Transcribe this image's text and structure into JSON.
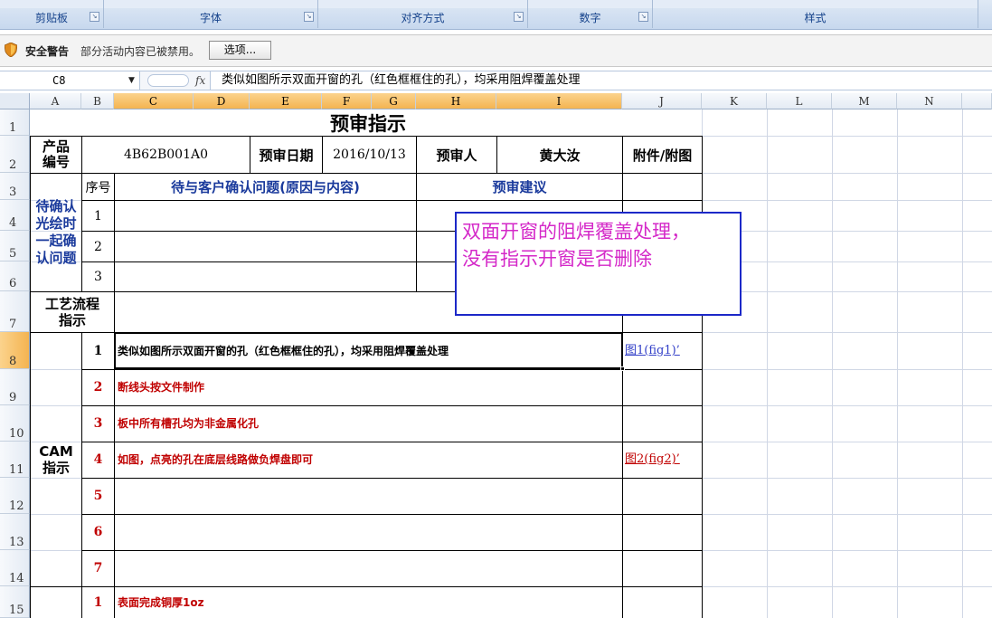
{
  "ribbon": {
    "groups": [
      "剪贴板",
      "字体",
      "对齐方式",
      "数字",
      "样式"
    ]
  },
  "security": {
    "title": "安全警告",
    "message": "部分活动内容已被禁用。",
    "options_button": "选项..."
  },
  "formula_bar": {
    "name_box": "C8",
    "fx": "fx",
    "content": "类似如图所示双面开窗的孔（红色框框住的孔），均采用阻焊覆盖处理"
  },
  "columns": [
    "A",
    "B",
    "C",
    "D",
    "E",
    "F",
    "G",
    "H",
    "I",
    "J",
    "K",
    "L",
    "M",
    "N"
  ],
  "rows": [
    "1",
    "2",
    "3",
    "4",
    "5",
    "6",
    "7",
    "8",
    "9",
    "10",
    "11",
    "12",
    "13",
    "14",
    "15"
  ],
  "sheet": {
    "title": "预审指示",
    "product_no_label": "产品\n编号",
    "product_no": "4B62B001A0",
    "review_date_label": "预审日期",
    "review_date": "2016/10/13",
    "reviewer_label": "预审人",
    "reviewer": "黄大汝",
    "attachment_label": "附件/附图",
    "seq_label": "序号",
    "issue_header": "待与客户确认问题(原因与内容)",
    "suggestion_header": "预审建议",
    "pending_label": "待确认\n光绘时\n一起确\n认问题",
    "pending_seq": [
      "1",
      "2",
      "3"
    ],
    "process_label": "工艺流程\n指示",
    "cam_label": "CAM\n指示",
    "cam_rows": [
      {
        "no": "1",
        "text": "类似如图所示双面开窗的孔（红色框框住的孔），均采用阻焊覆盖处理",
        "link": "图1(fig1)’"
      },
      {
        "no": "2",
        "text": "断线头按文件制作",
        "link": ""
      },
      {
        "no": "3",
        "text": "板中所有槽孔均为非金属化孔",
        "link": ""
      },
      {
        "no": "4",
        "text": "如图，点亮的孔在底层线路做负焊盘即可",
        "link": "图2(fig2)’"
      },
      {
        "no": "5",
        "text": "",
        "link": ""
      },
      {
        "no": "6",
        "text": "",
        "link": ""
      },
      {
        "no": "7",
        "text": "",
        "link": ""
      }
    ],
    "row15": {
      "no": "1",
      "text": "表面完成铜厚1oz"
    }
  },
  "note_box": "双面开窗的阻焊覆盖处理，\n没有指示开窗是否删除",
  "colors": {
    "accent_blue": "#1a3a9c",
    "accent_red": "#c00000",
    "note_border": "#1c28c8",
    "note_text": "#d428c8",
    "selected_header": "#f4b451"
  }
}
